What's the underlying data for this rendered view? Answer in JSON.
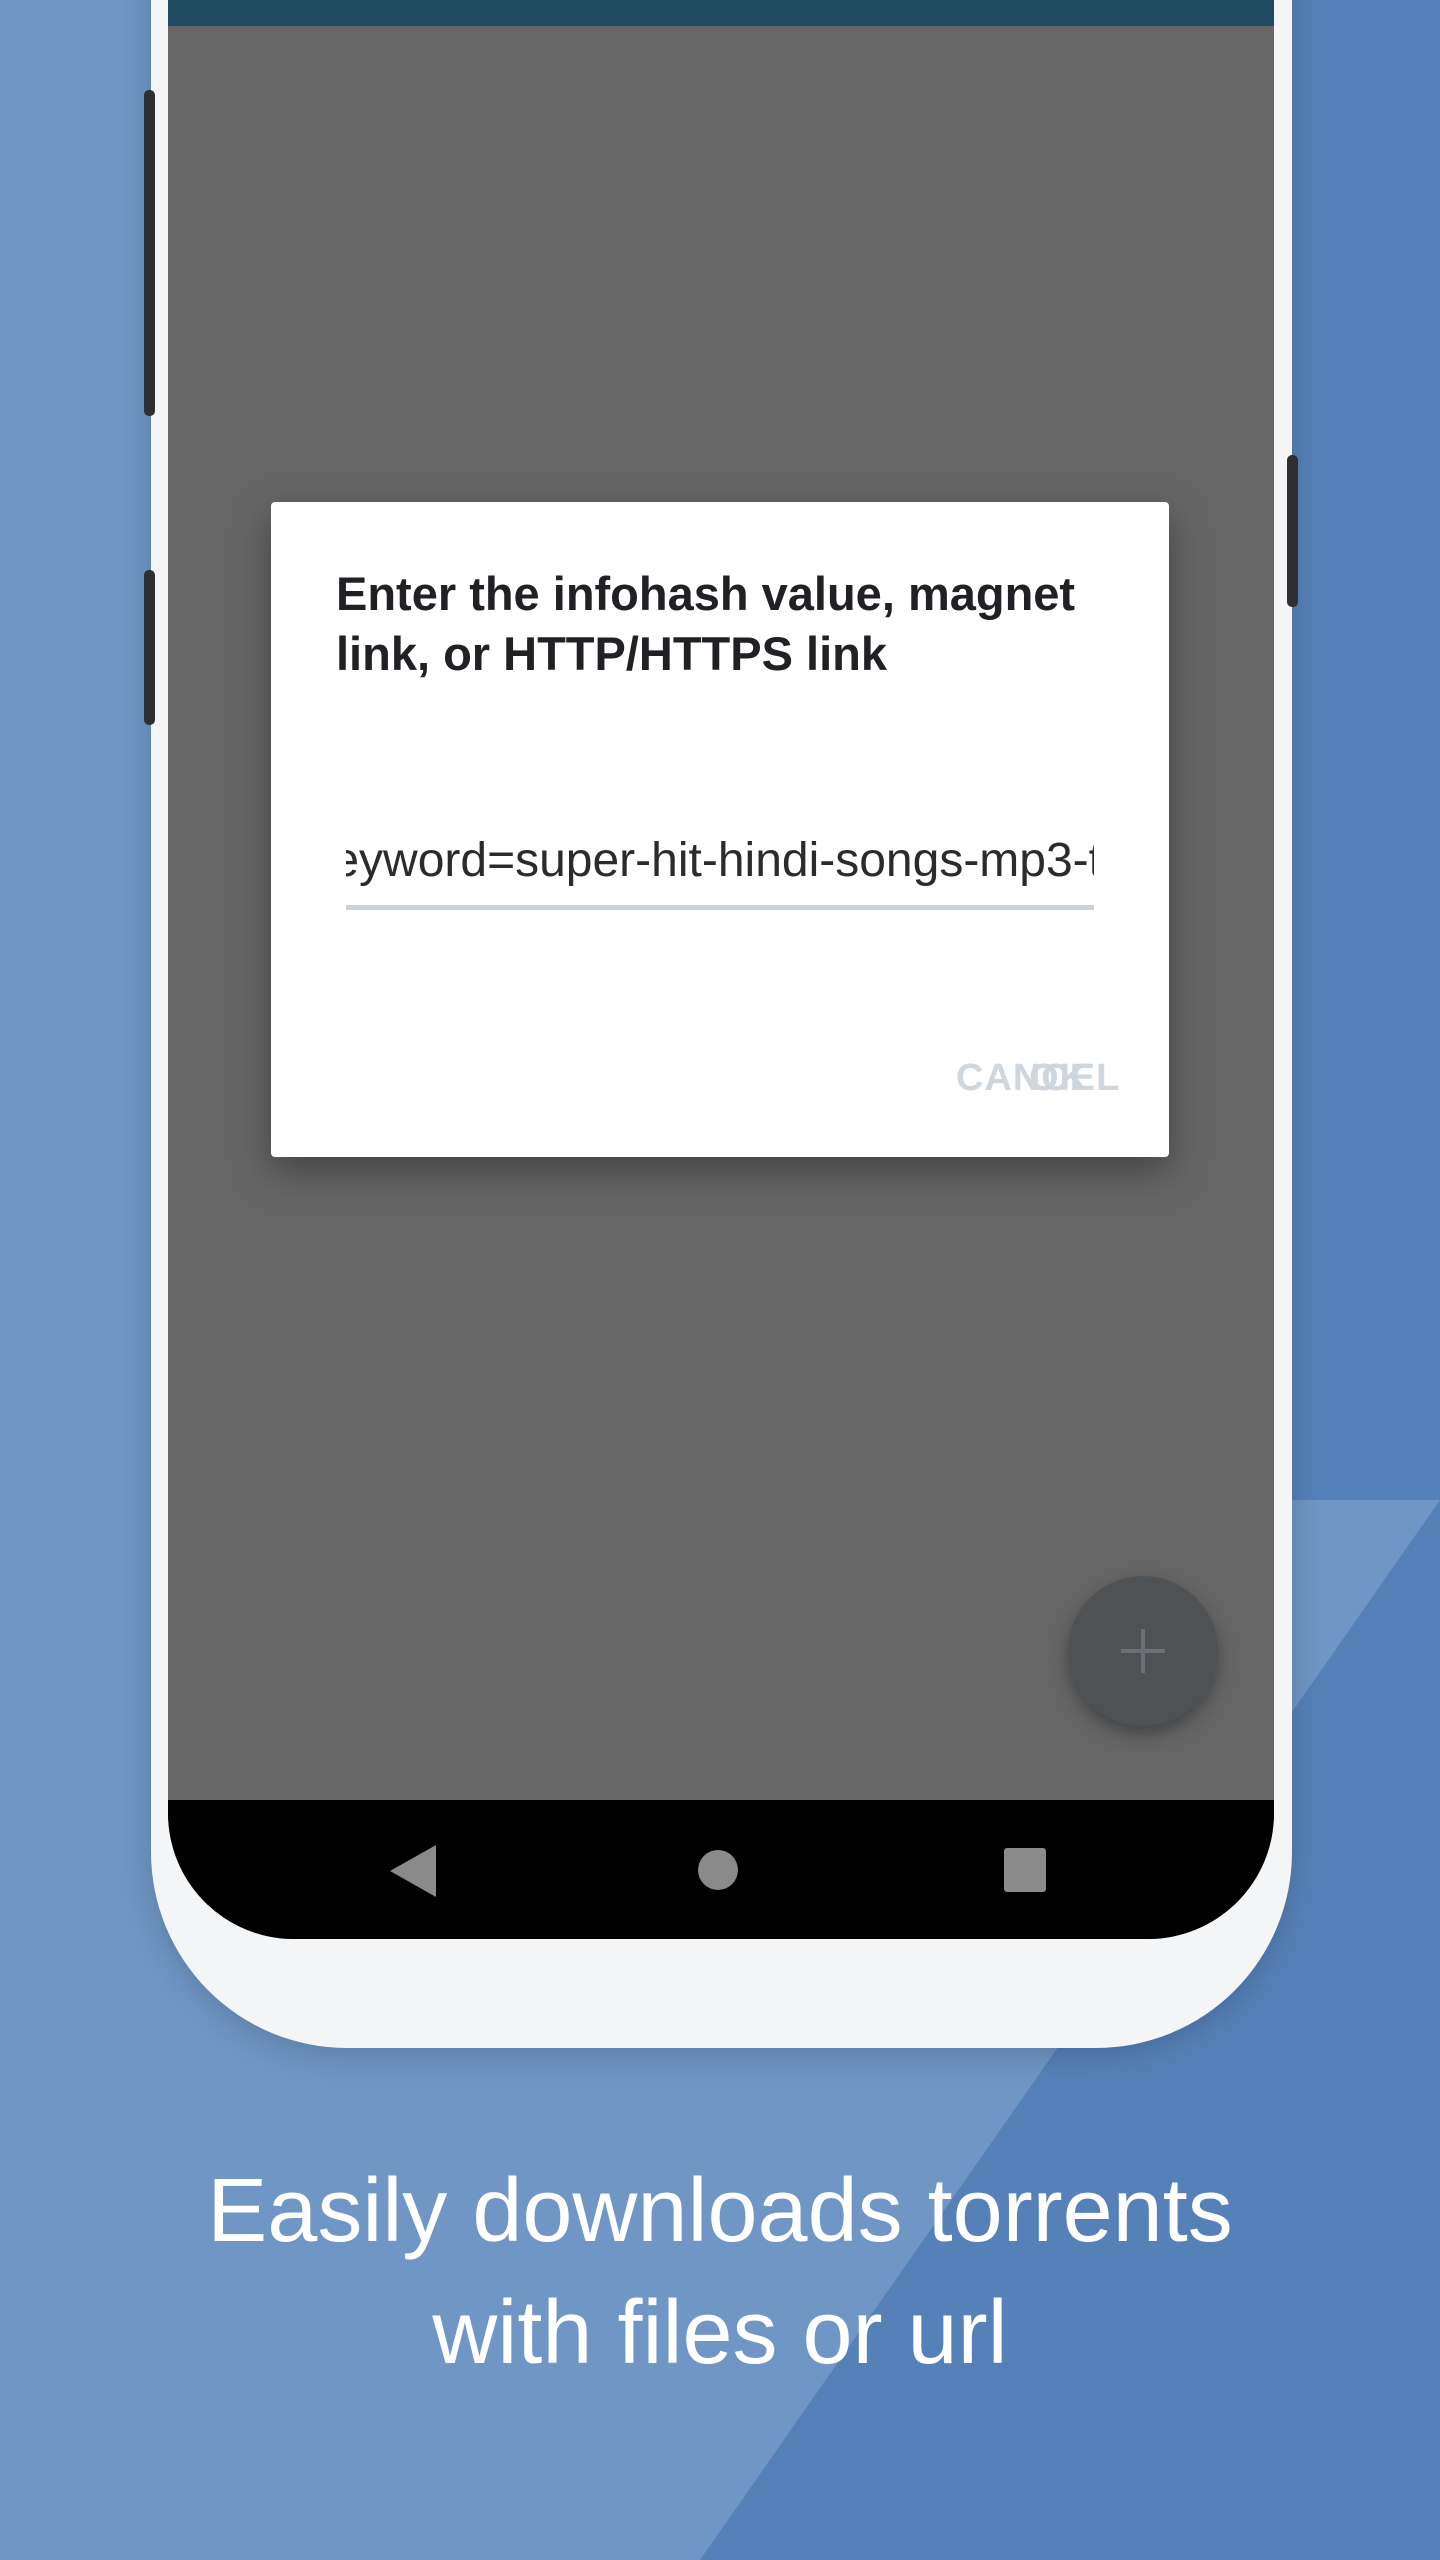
{
  "colors": {
    "background_light": "#6f96c4",
    "background_dark": "#5581b8",
    "app_bar": "#1e4b5f",
    "scrim": "#666666",
    "dialog": "#ffffff",
    "input_underline": "#c6d2de",
    "button_disabled": "#cfd6de",
    "fab": "#4f5255"
  },
  "dialog": {
    "title": "Enter the infohash value, magnet link, or HTTP/HTTPS link",
    "input_value": "eyword=super-hit-hindi-songs-mp3-t",
    "cancel_label": "CANCEL",
    "ok_label": "OK"
  },
  "fab": {
    "icon": "plus-icon"
  },
  "navigation": {
    "back_icon": "back-triangle-icon",
    "home_icon": "home-circle-icon",
    "recents_icon": "recents-square-icon"
  },
  "caption": {
    "line1": "Easily downloads torrents",
    "line2": "with files or url"
  }
}
